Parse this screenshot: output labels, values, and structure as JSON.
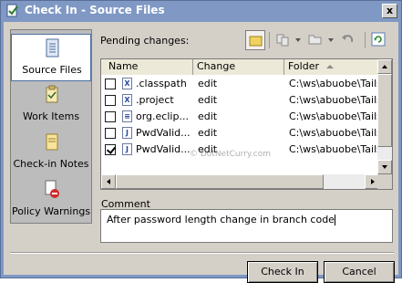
{
  "window": {
    "title": "Check In - Source Files",
    "close_label": "x"
  },
  "nav": {
    "items": [
      {
        "label": "Source Files",
        "icon": "source-files-icon",
        "selected": true
      },
      {
        "label": "Work Items",
        "icon": "work-items-icon",
        "selected": false
      },
      {
        "label": "Check-in Notes",
        "icon": "checkin-notes-icon",
        "selected": false
      },
      {
        "label": "Policy Warnings",
        "icon": "policy-warnings-icon",
        "selected": false
      }
    ]
  },
  "pending": {
    "label": "Pending changes:",
    "columns": [
      "Name",
      "Change",
      "Folder"
    ],
    "rows": [
      {
        "checked": false,
        "icon": "X",
        "name": ".classpath",
        "change": "edit",
        "folder": "C:\\ws\\abuobe\\Tailspin"
      },
      {
        "checked": false,
        "icon": "X",
        "name": ".project",
        "change": "edit",
        "folder": "C:\\ws\\abuobe\\Tailspin"
      },
      {
        "checked": false,
        "icon": "≡",
        "name": "org.eclip...",
        "change": "edit",
        "folder": "C:\\ws\\abuobe\\Tailspin"
      },
      {
        "checked": false,
        "icon": "J",
        "name": "PwdValid...",
        "change": "edit",
        "folder": "C:\\ws\\abuobe\\Tailspin"
      },
      {
        "checked": true,
        "icon": "J",
        "name": "PwdValid...",
        "change": "edit",
        "folder": "C:\\ws\\abuobe\\Tailspin"
      }
    ]
  },
  "comment": {
    "label": "Comment",
    "value": "After password length change in branch code"
  },
  "buttons": {
    "check_in": "Check In",
    "cancel": "Cancel"
  },
  "watermark": "© DotNetCurry.com",
  "colors": {
    "titlebar": "#7f98c4",
    "dialog": "#d4d0c8",
    "nav": "#bcbcbc",
    "selection_border": "#4a6ea0"
  }
}
